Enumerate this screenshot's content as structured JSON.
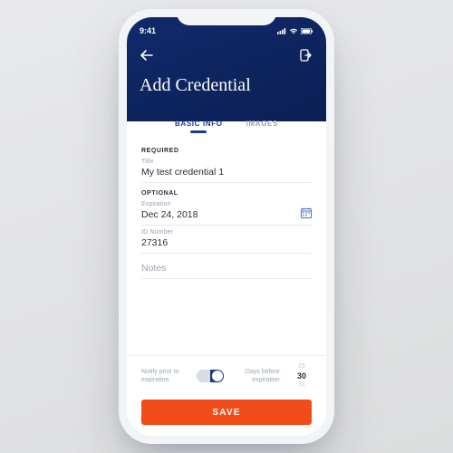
{
  "status": {
    "time": "9:41"
  },
  "header": {
    "title": "Add Credential"
  },
  "tabs": {
    "basic": "BASIC INFO",
    "images": "IMAGES"
  },
  "sections": {
    "required": "REQUIRED",
    "optional": "OPTIONAL"
  },
  "fields": {
    "title": {
      "label": "Title",
      "value": "My test credential 1"
    },
    "expiration": {
      "label": "Expiration",
      "value": "Dec 24, 2018"
    },
    "idnumber": {
      "label": "ID Number",
      "value": "27316"
    },
    "notes": {
      "placeholder": "Notes"
    }
  },
  "notify": {
    "label": "Notify prior to expiration",
    "days_label": "Days before expiration",
    "picker": {
      "prev": "29",
      "current": "30",
      "next": "31"
    }
  },
  "actions": {
    "save": "SAVE"
  }
}
